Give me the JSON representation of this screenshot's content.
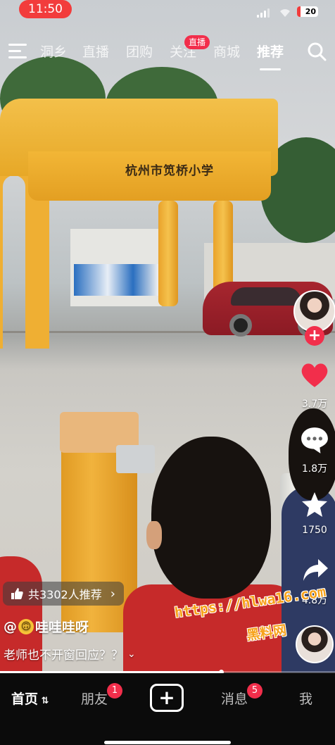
{
  "status_bar": {
    "time": "11:50",
    "battery": "20"
  },
  "top_nav": {
    "tabs": [
      {
        "label": "洞乡"
      },
      {
        "label": "直播"
      },
      {
        "label": "团购"
      },
      {
        "label": "关注"
      },
      {
        "label": "商城"
      },
      {
        "label": "推荐"
      }
    ],
    "active_tab": "推荐",
    "live_badge": "直播"
  },
  "video": {
    "scene_sign": "杭州市笕桥小学",
    "recommend_text": "共3302人推荐",
    "author": "@🙃哇哇哇呀",
    "author_name": "哇哇哇呀",
    "caption": "老师也不开窗回应？？",
    "watermark_url": "https://hlwa16.com",
    "watermark_text": "黑料网",
    "progress": 0.66
  },
  "right_rail": {
    "like_count": "3.7万",
    "comment_count": "1.8万",
    "favorite_count": "1750",
    "share_count": "4.8万"
  },
  "bottom_tabs": {
    "home": "首页",
    "friends": "朋友",
    "friends_badge": "1",
    "messages": "消息",
    "messages_badge": "5",
    "me": "我"
  },
  "colors": {
    "accent": "#f22e4b",
    "status_red": "#f23c3c",
    "watermark": "#f7a21b"
  }
}
